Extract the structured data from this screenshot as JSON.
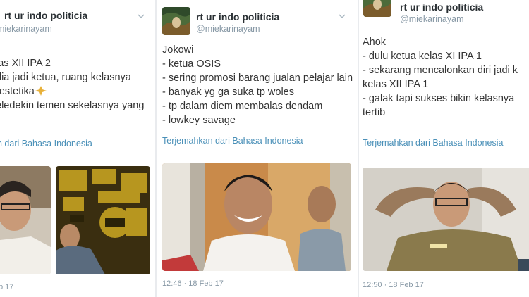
{
  "tweets": [
    {
      "display_name": "rt ur indo politicia",
      "handle": "miekarinayam",
      "lines": [
        "las XII IPA 2",
        "dia jadi ketua, ruang kelasnya",
        "restetika",
        "eledekin temen sekelasnya yang"
      ],
      "translate_label": "n dari Bahasa Indonesia",
      "timestamp": "b 17"
    },
    {
      "display_name": "rt ur indo politicia",
      "handle": "@miekarinayam",
      "lines": [
        "Jokowi",
        "- ketua OSIS",
        "- sering promosi barang jualan pelajar lain",
        "- banyak yg ga suka tp woles",
        "- tp dalam diem membalas dendam",
        "- lowkey savage"
      ],
      "translate_label": "Terjemahkan dari Bahasa Indonesia",
      "timestamp": "12:46 · 18 Feb 17"
    },
    {
      "display_name": "rt ur indo politicia",
      "handle": "@miekarinayam",
      "lines": [
        "Ahok",
        "- dulu ketua kelas XI IPA 1",
        "- sekarang mencalonkan diri jadi k",
        "kelas XII IPA 1",
        "- galak tapi sukses bikin kelasnya",
        "tertib"
      ],
      "translate_label": "Terjemahkan dari Bahasa Indonesia",
      "timestamp": "12:50 · 18 Feb 17"
    }
  ],
  "icons": {
    "chevron": "chevron-down-icon",
    "emoji": "sparkle-emoji-icon"
  },
  "colors": {
    "name": "#292f33",
    "handle": "#8899a6",
    "link": "#4a90b8",
    "emoji": "#e8b13a"
  }
}
